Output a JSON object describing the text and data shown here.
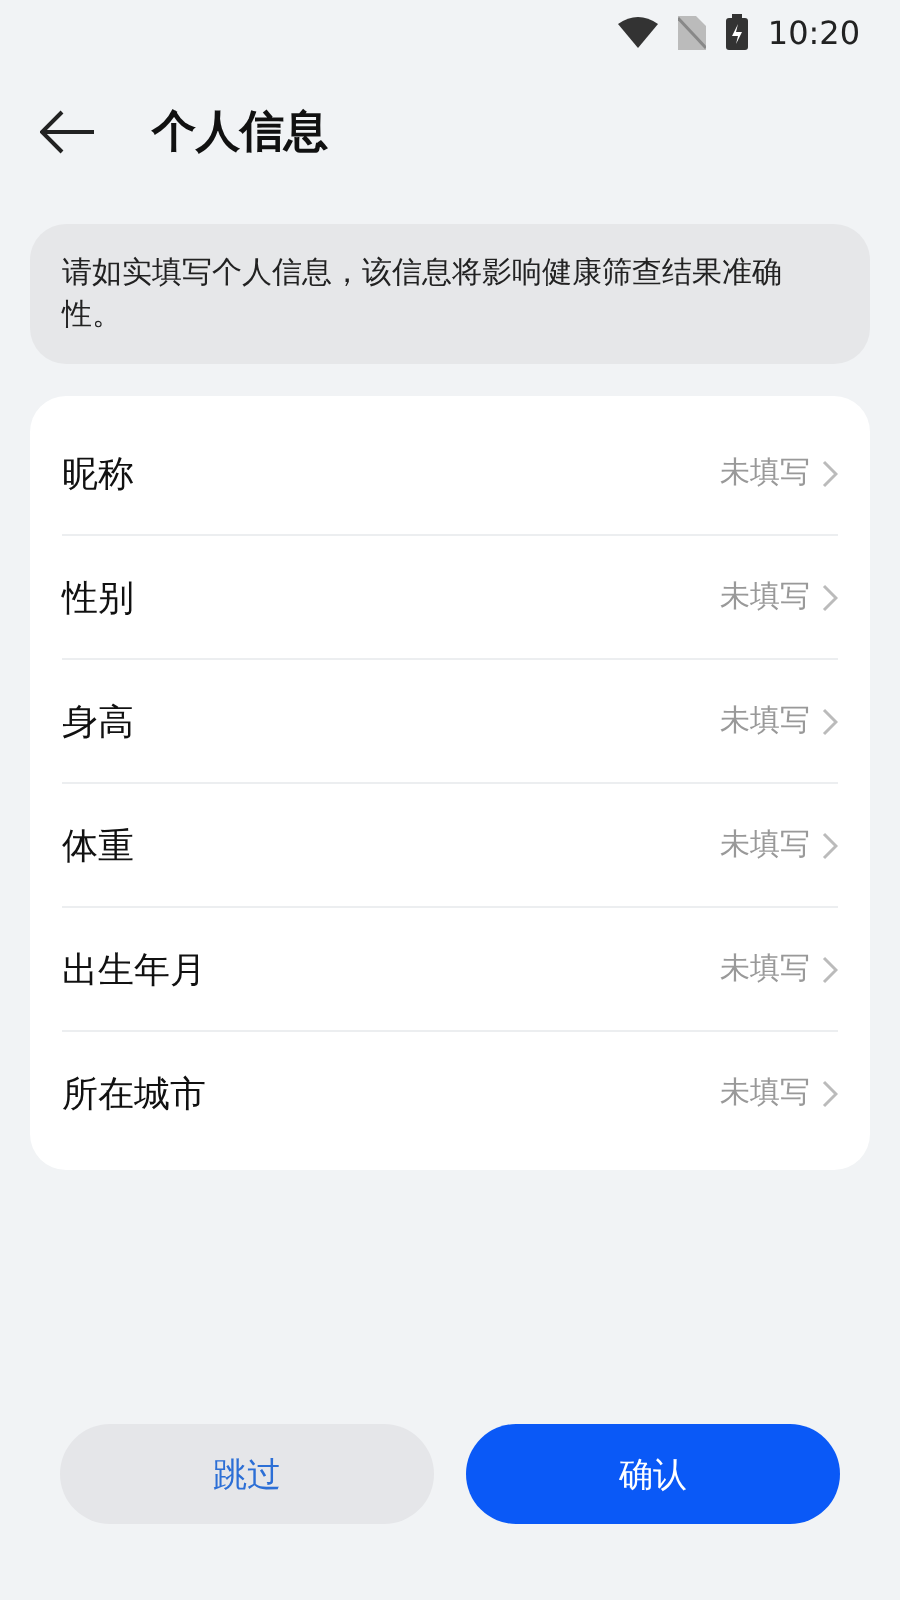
{
  "status_bar": {
    "time": "10:20"
  },
  "header": {
    "title": "个人信息"
  },
  "notice": "请如实填写个人信息，该信息将影响健康筛查结果准确性。",
  "fields": [
    {
      "label": "昵称",
      "value": "未填写"
    },
    {
      "label": "性别",
      "value": "未填写"
    },
    {
      "label": "身高",
      "value": "未填写"
    },
    {
      "label": "体重",
      "value": "未填写"
    },
    {
      "label": "出生年月",
      "value": "未填写"
    },
    {
      "label": "所在城市",
      "value": "未填写"
    }
  ],
  "buttons": [
    {
      "kind": "secondary",
      "label": "跳过"
    },
    {
      "kind": "primary",
      "label": "确认"
    }
  ]
}
